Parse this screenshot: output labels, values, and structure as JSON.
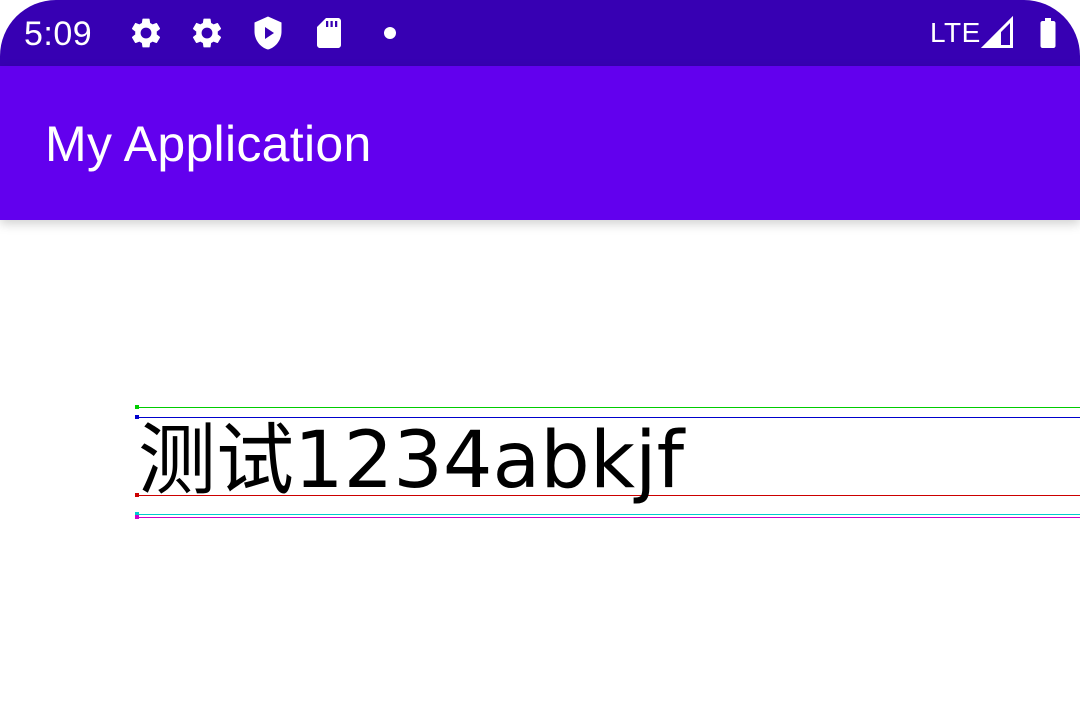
{
  "status_bar": {
    "time": "5:09",
    "network": "LTE",
    "background": "#3700b3",
    "icons": [
      "settings-icon",
      "settings-icon",
      "shield-play-icon",
      "sd-card-icon",
      "notification-dot-icon",
      "signal-icon",
      "battery-icon"
    ]
  },
  "app_bar": {
    "title": "My Application",
    "background": "#6200ee"
  },
  "content": {
    "sample_text": "测试1234abkjf",
    "metric_line_colors": {
      "top": "#00cc00",
      "ascent": "#0000cc",
      "baseline": "#cc0000",
      "descent": "#00cccc",
      "bottom": "#cc00cc"
    }
  }
}
